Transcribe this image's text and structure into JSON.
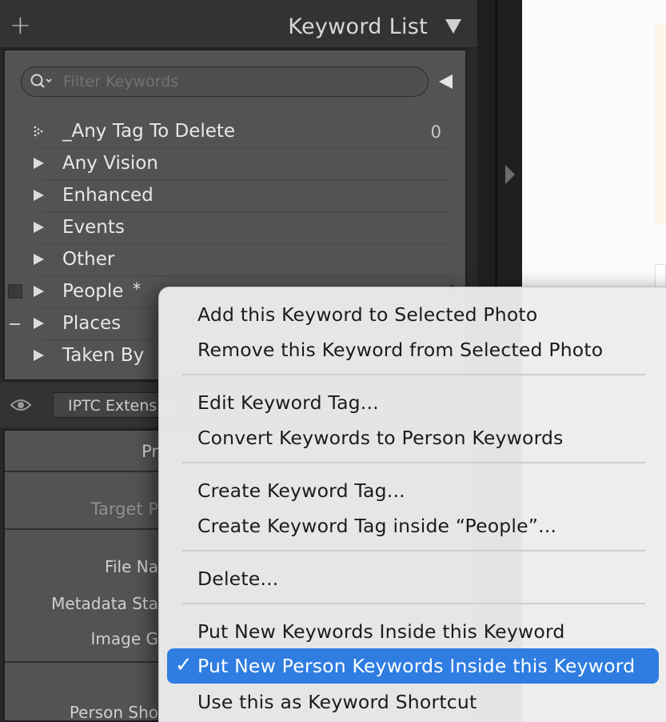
{
  "keyword_panel": {
    "title": "Keyword List",
    "add_icon": "plus-icon",
    "collapse_icon": "triangle-down-icon",
    "filter": {
      "placeholder": "Filter Keywords",
      "value": ""
    },
    "keywords": [
      {
        "label": "_Any Tag To Delete",
        "count": "0"
      },
      {
        "label": "Any Vision"
      },
      {
        "label": "Enhanced"
      },
      {
        "label": "Events"
      },
      {
        "label": "Other"
      },
      {
        "label": "People",
        "marker": "*"
      },
      {
        "label": "Places"
      },
      {
        "label": "Taken By"
      }
    ]
  },
  "metadata_panel": {
    "preset": "IPTC Extensio",
    "section_1": "Pr",
    "section_2": "Target P",
    "labels": [
      "File Na",
      "Metadata Sta",
      "Image G",
      "Person Sho"
    ]
  },
  "context_menu": {
    "items": [
      "Add this Keyword to Selected Photo",
      "Remove this Keyword from Selected Photo",
      "Edit Keyword Tag...",
      "Convert Keywords to Person Keywords",
      "Create Keyword Tag...",
      "Create Keyword Tag inside “People”...",
      "Delete...",
      "Put New Keywords Inside this Keyword",
      "Put New Person Keywords Inside this Keyword",
      "Use this as Keyword Shortcut"
    ],
    "selected_check": "✓"
  },
  "colors": {
    "menu_highlight": "#2f7de1",
    "panel_bg": "#535353"
  }
}
